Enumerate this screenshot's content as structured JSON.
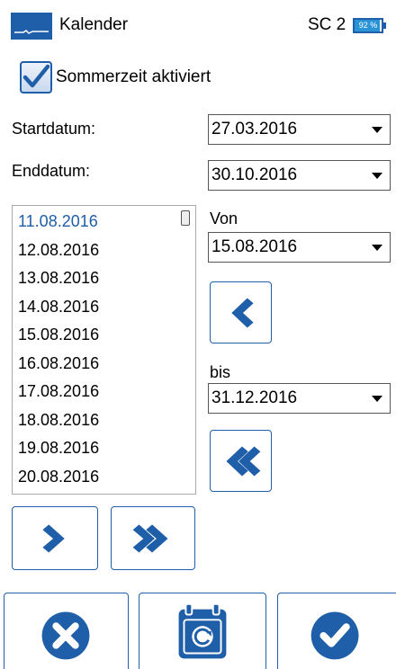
{
  "header": {
    "title": "Kalender",
    "device": "SC 2",
    "battery_percent": 92,
    "battery_text": "92 %"
  },
  "dst": {
    "label": "Sommerzeit aktiviert",
    "checked": true
  },
  "start": {
    "label": "Startdatum:",
    "value": "27.03.2016"
  },
  "end": {
    "label": "Enddatum:",
    "value": "30.10.2016"
  },
  "date_list": {
    "items": [
      "11.08.2016",
      "12.08.2016",
      "13.08.2016",
      "14.08.2016",
      "15.08.2016",
      "16.08.2016",
      "17.08.2016",
      "18.08.2016",
      "19.08.2016",
      "20.08.2016"
    ],
    "selected_index": 0
  },
  "from": {
    "label": "Von",
    "value": "15.08.2016"
  },
  "to": {
    "label": "bis",
    "value": "31.12.2016"
  },
  "colors": {
    "accent": "#1f5ea8",
    "selected_text": "#1f5ea8"
  },
  "icons": {
    "step_back": "chevron-left-icon",
    "jump_back": "double-chevron-left-icon",
    "step_forward": "chevron-right-icon",
    "jump_forward": "double-chevron-right-icon",
    "cancel": "cancel-icon",
    "calendar_reset": "calendar-reset-icon",
    "confirm": "confirm-icon"
  }
}
